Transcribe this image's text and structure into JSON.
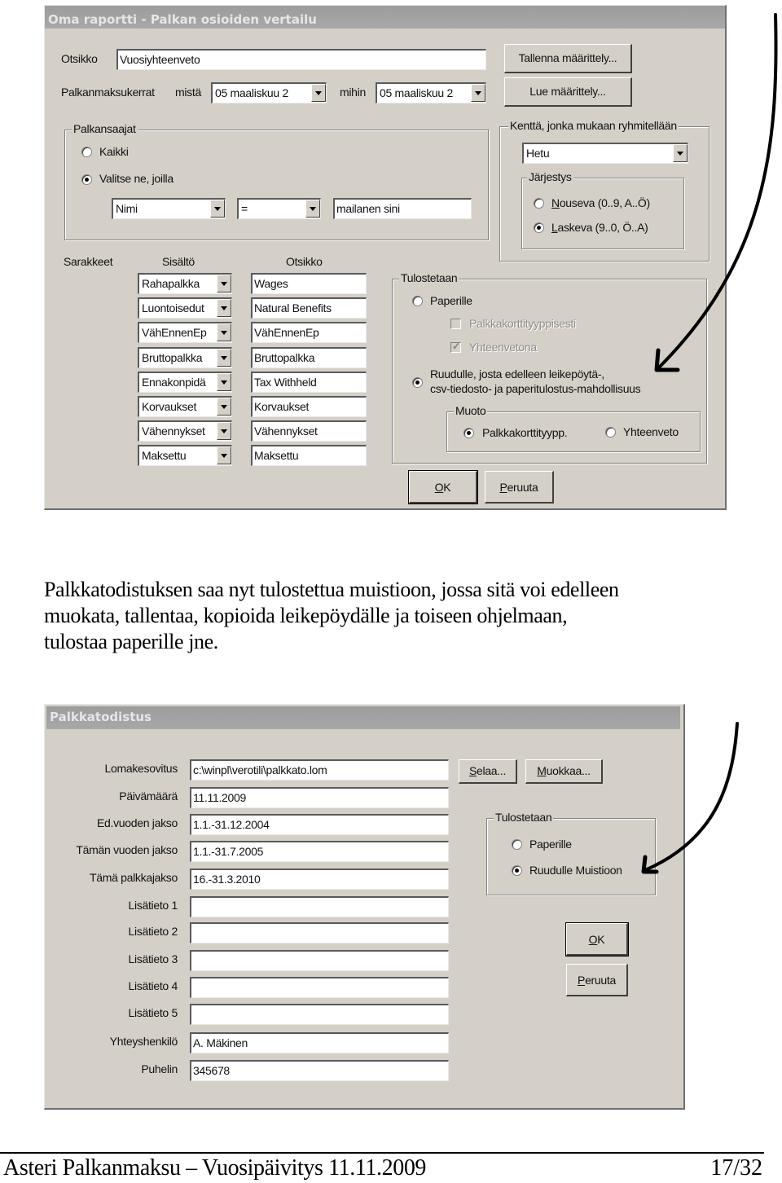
{
  "dialog1": {
    "title": "Oma raportti - Palkan osioiden vertailu",
    "otsikko_label": "Otsikko",
    "otsikko_value": "Vuosiyhteenveto",
    "palkanmaksukerrat_label": "Palkanmaksukerrat",
    "mista_label": "mistä",
    "mista_value": "05 maaliskuu 2",
    "mihin_label": "mihin",
    "mihin_value": "05 maaliskuu 2",
    "save_definition_button": "Tallenna määrittely...",
    "load_definition_button": "Lue määrittely...",
    "palkansaajat": {
      "title": "Palkansaajat",
      "option_all": "Kaikki",
      "option_select": "Valitse ne, joilla",
      "selected": "Valitse ne, joilla",
      "filter_field": "Nimi",
      "filter_operator": "=",
      "filter_value": "mailanen sini"
    },
    "grouping": {
      "title": "Kenttä, jonka mukaan ryhmitellään",
      "field_value": "Hetu",
      "order_title": "Järjestys",
      "ascending": "Nouseva (0..9, A..Ö)",
      "descending": "Laskeva (9..0, Ö..A)",
      "selected": "Laskeva (9..0, Ö..A)"
    },
    "columns": {
      "label": "Sarakkeet",
      "content_header": "Sisältö",
      "title_header": "Otsikko",
      "rows": [
        {
          "content": "Rahapalkka",
          "title": "Wages"
        },
        {
          "content": "Luontoisedut",
          "title": "Natural Benefits"
        },
        {
          "content": "VähEnnenEp",
          "title": "VähEnnenEp"
        },
        {
          "content": "Bruttopalkka",
          "title": "Bruttopalkka"
        },
        {
          "content": "Ennakonpidä",
          "title": "Tax Withheld"
        },
        {
          "content": "Korvaukset",
          "title": "Korvaukset"
        },
        {
          "content": "Vähennykset",
          "title": "Vähennykset"
        },
        {
          "content": "Maksettu",
          "title": "Maksettu"
        }
      ]
    },
    "output": {
      "title": "Tulostetaan",
      "paper": "Paperille",
      "per_card": "Palkkakorttityyppisesti",
      "per_card_checked": false,
      "summary": "Yhteenvetona",
      "summary_checked": true,
      "screen_line1": "Ruudulle, josta edelleen leikepöytä-,",
      "screen_line2": "csv-tiedosto- ja paperitulostus-mahdollisuus",
      "selected": "Ruudulle",
      "format_title": "Muoto",
      "format_card": "Palkkakorttityypp.",
      "format_summary": "Yhteenveto",
      "format_selected": "Palkkakorttityypp."
    },
    "ok_button": "OK",
    "cancel_button": "Peruuta"
  },
  "paragraph": {
    "line1": "Palkkatodistuksen saa nyt tulostettua muistioon, jossa sitä voi edelleen",
    "line2": "muokata, tallentaa, kopioida leikepöydälle ja toiseen ohjelmaan,",
    "line3": "tulostaa paperille jne."
  },
  "dialog2": {
    "title": "Palkkatodistus",
    "fields": [
      {
        "label": "Lomakesovitus",
        "value": "c:\\winpl\\verotili\\palkkato.lom"
      },
      {
        "label": "Päivämäärä",
        "value": "11.11.2009"
      },
      {
        "label": "Ed.vuoden jakso",
        "value": "1.1.-31.12.2004"
      },
      {
        "label": "Tämän vuoden jakso",
        "value": "1.1.-31.7.2005"
      },
      {
        "label": "Tämä palkkajakso",
        "value": "16.-31.3.2010"
      },
      {
        "label": "Lisätieto 1",
        "value": ""
      },
      {
        "label": "Lisätieto 2",
        "value": ""
      },
      {
        "label": "Lisätieto 3",
        "value": ""
      },
      {
        "label": "Lisätieto 4",
        "value": ""
      },
      {
        "label": "Lisätieto 5",
        "value": ""
      },
      {
        "label": "Yhteyshenkilö",
        "value": "A. Mäkinen"
      },
      {
        "label": "Puhelin",
        "value": "345678"
      }
    ],
    "browse_button": "Selaa...",
    "edit_button": "Muokkaa...",
    "output": {
      "title": "Tulostetaan",
      "paper": "Paperille",
      "screen": "Ruudulle Muistioon",
      "selected": "Ruudulle Muistioon"
    },
    "ok_button": "OK",
    "cancel_button": "Peruuta"
  },
  "footer": {
    "left": "Asteri Palkanmaksu – Vuosipäivitys 11.11.2009",
    "right": "17/32"
  }
}
